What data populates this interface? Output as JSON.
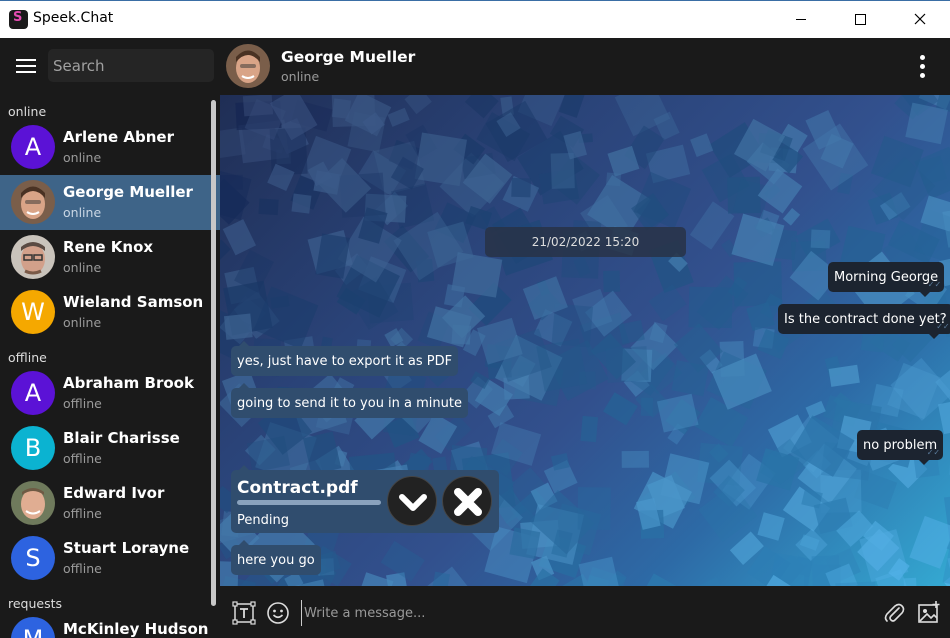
{
  "window": {
    "title": "Speek.Chat"
  },
  "sidebar": {
    "search_placeholder": "Search",
    "sections": {
      "online": "online",
      "offline": "offline",
      "requests": "requests"
    },
    "contacts": [
      {
        "name": "Arlene Abner",
        "status": "online",
        "initial": "A",
        "color": "#5b12d6"
      },
      {
        "name": "George Mueller",
        "status": "online",
        "initial": "",
        "color": "#8a6a55"
      },
      {
        "name": "Rene Knox",
        "status": "online",
        "initial": "",
        "color": "#7a6a5e"
      },
      {
        "name": "Wieland Samson",
        "status": "online",
        "initial": "W",
        "color": "#f5a800"
      },
      {
        "name": "Abraham Brook",
        "status": "offline",
        "initial": "A",
        "color": "#5b12d6"
      },
      {
        "name": "Blair Charisse",
        "status": "offline",
        "initial": "B",
        "color": "#0bb3d1"
      },
      {
        "name": "Edward Ivor",
        "status": "offline",
        "initial": "",
        "color": "#7d8a6a"
      },
      {
        "name": "Stuart Lorayne",
        "status": "offline",
        "initial": "S",
        "color": "#2d63e0"
      },
      {
        "name": "McKinley Hudson",
        "status": "",
        "initial": "M",
        "color": "#2d63e0"
      }
    ]
  },
  "chat": {
    "name": "George Mueller",
    "status": "online",
    "date": "21/02/2022 15:20",
    "messages": [
      {
        "text": "Morning George",
        "direction": "out"
      },
      {
        "text": "Is the contract done yet?",
        "direction": "out"
      },
      {
        "text": "yes, just have to export it as PDF",
        "direction": "in"
      },
      {
        "text": "going to send it to you in a minute",
        "direction": "in"
      },
      {
        "text": "no problem",
        "direction": "out"
      },
      {
        "text": "here you go",
        "direction": "in"
      }
    ],
    "file": {
      "name": "Contract.pdf",
      "status": "Pending",
      "progress": 1.0
    }
  },
  "composer": {
    "placeholder": "Write a message..."
  },
  "icons": {
    "app": "speek-logo-icon",
    "menu": "hamburger-menu-icon",
    "more": "more-vertical-icon",
    "text_format": "text-format-icon",
    "emoji": "emoji-icon",
    "attach": "paperclip-icon",
    "image": "image-icon",
    "accept": "check-icon",
    "cancel": "close-icon"
  }
}
